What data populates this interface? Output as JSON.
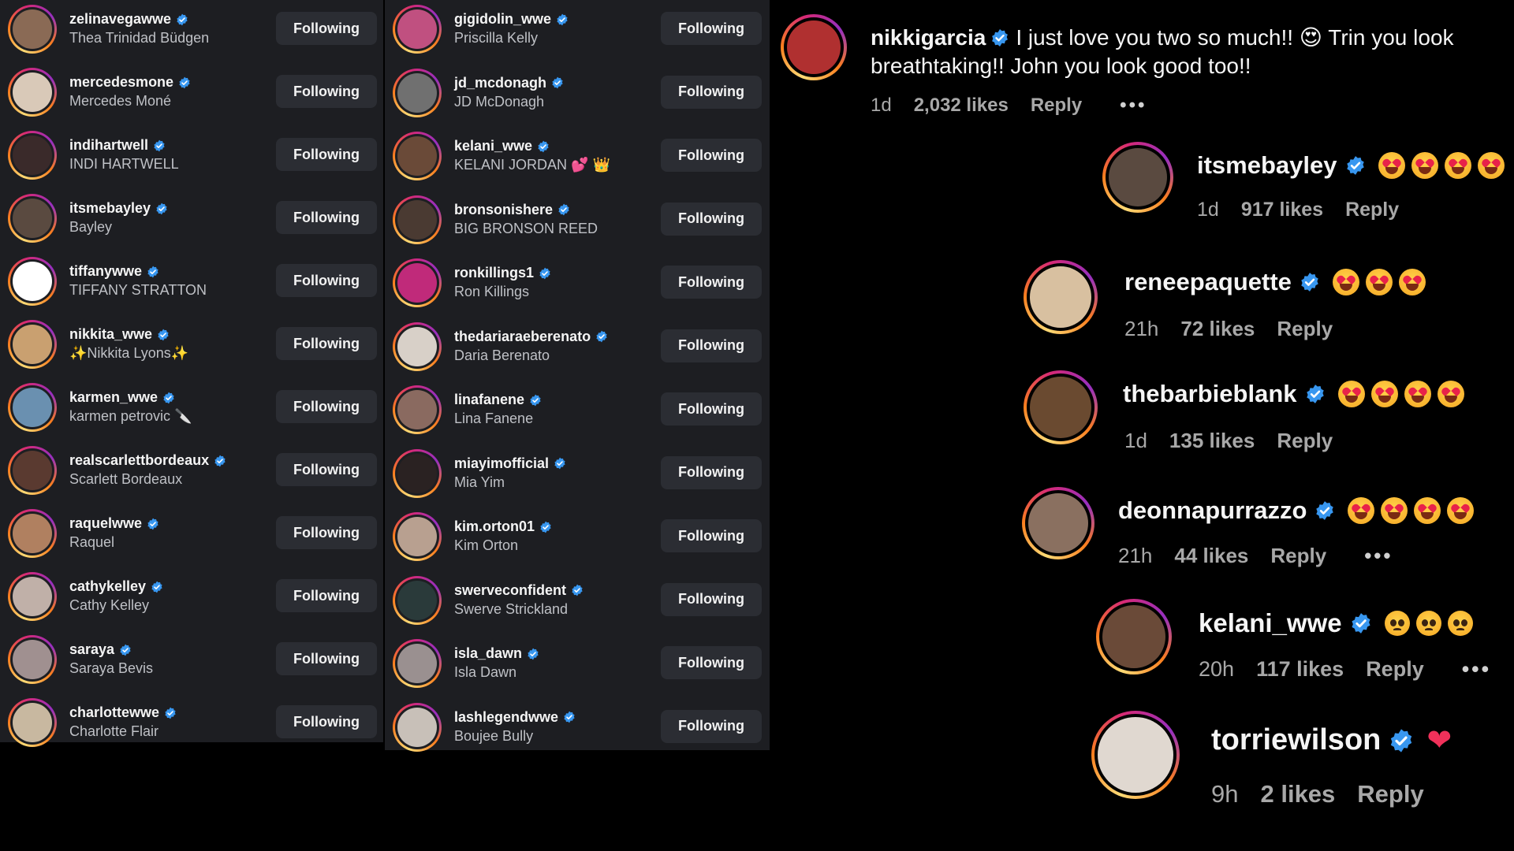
{
  "colors": {
    "background": "#000000",
    "panel": "#1d1e22",
    "verified": "#3897f0",
    "button": "#2b2d33"
  },
  "following_button_label": "Following",
  "left_list": [
    {
      "username": "zelinavegawwe",
      "name": "Thea Trinidad Büdgen",
      "avatar_color": "#8a6a55"
    },
    {
      "username": "mercedesmone",
      "name": "Mercedes Moné",
      "avatar_color": "#d9c9b8"
    },
    {
      "username": "indihartwell",
      "name": "INDI HARTWELL",
      "avatar_color": "#3a2a2a"
    },
    {
      "username": "itsmebayley",
      "name": "Bayley",
      "avatar_color": "#5a4a40"
    },
    {
      "username": "tiffanywwe",
      "name": "TIFFANY STRATTON",
      "avatar_color": "#ffffff"
    },
    {
      "username": "nikkita_wwe",
      "name": "✨Nikkita Lyons✨",
      "avatar_color": "#c9a070"
    },
    {
      "username": "karmen_wwe",
      "name": "karmen petrovic 🔪",
      "avatar_color": "#6a90b0"
    },
    {
      "username": "realscarlettbordeaux",
      "name": "Scarlett Bordeaux",
      "avatar_color": "#5a3a30"
    },
    {
      "username": "raquelwwe",
      "name": "Raquel",
      "avatar_color": "#b08060"
    },
    {
      "username": "cathykelley",
      "name": "Cathy Kelley",
      "avatar_color": "#c0b0a8"
    },
    {
      "username": "saraya",
      "name": "Saraya Bevis",
      "avatar_color": "#a09090"
    },
    {
      "username": "charlottewwe",
      "name": "Charlotte Flair",
      "avatar_color": "#c8b8a0"
    }
  ],
  "right_list": [
    {
      "username": "gigidolin_wwe",
      "name": "Priscilla Kelly",
      "avatar_color": "#c05080"
    },
    {
      "username": "jd_mcdonagh",
      "name": "JD McDonagh",
      "avatar_color": "#707070"
    },
    {
      "username": "kelani_wwe",
      "name": "KELANI JORDAN 💕 👑",
      "avatar_color": "#6a4a38"
    },
    {
      "username": "bronsonishere",
      "name": "BIG BRONSON REED",
      "avatar_color": "#4a3a32"
    },
    {
      "username": "ronkillings1",
      "name": "Ron Killings",
      "avatar_color": "#c02a7a"
    },
    {
      "username": "thedariaraeberenato",
      "name": "Daria Berenato",
      "avatar_color": "#d8d0c8"
    },
    {
      "username": "linafanene",
      "name": "Lina Fanene",
      "avatar_color": "#8a6a60"
    },
    {
      "username": "miayimofficial",
      "name": "Mia Yim",
      "avatar_color": "#2a2222"
    },
    {
      "username": "kim.orton01",
      "name": "Kim Orton",
      "avatar_color": "#b8a090"
    },
    {
      "username": "swerveconfident",
      "name": "Swerve Strickland",
      "avatar_color": "#2a3a3a"
    },
    {
      "username": "isla_dawn",
      "name": "Isla Dawn",
      "avatar_color": "#9a9090"
    },
    {
      "username": "lashlegendwwe",
      "name": "Boujee Bully",
      "avatar_color": "#c8c0b8"
    }
  ],
  "comments": [
    {
      "username": "nikkigarcia",
      "text": "I just love you two so much!! 😍 Trin you look breathtaking!! John you look good too!!",
      "time": "1d",
      "likes": "2,032 likes",
      "reply": "Reply",
      "more": "•••",
      "avatar_color": "#b03030"
    },
    {
      "username": "itsmebayley",
      "emojis": "heart-eyes x4",
      "time": "1d",
      "likes": "917 likes",
      "reply": "Reply",
      "avatar_color": "#5a4a40"
    },
    {
      "username": "reneepaquette",
      "emojis": "heart-eyes x3",
      "time": "21h",
      "likes": "72 likes",
      "reply": "Reply",
      "avatar_color": "#d8c0a0"
    },
    {
      "username": "thebarbieblank",
      "emojis": "heart-eyes x4",
      "time": "1d",
      "likes": "135 likes",
      "reply": "Reply",
      "avatar_color": "#6a4a30"
    },
    {
      "username": "deonnapurrazzo",
      "emojis": "heart-eyes x4",
      "time": "21h",
      "likes": "44 likes",
      "reply": "Reply",
      "more": "•••",
      "avatar_color": "#8a7060"
    },
    {
      "username": "kelani_wwe",
      "emojis": "pleading x3",
      "time": "20h",
      "likes": "117 likes",
      "reply": "Reply",
      "more": "•••",
      "avatar_color": "#6a4a38"
    },
    {
      "username": "torriewilson",
      "emojis": "red heart",
      "time": "9h",
      "likes": "2 likes",
      "reply": "Reply",
      "avatar_color": "#e0d8d0"
    }
  ]
}
